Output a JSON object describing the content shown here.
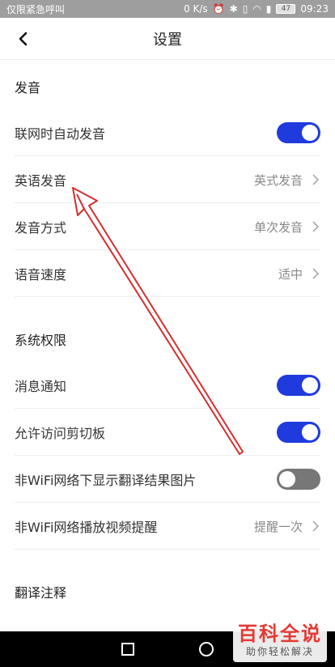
{
  "status_bar": {
    "left_text": "仅限紧急呼叫",
    "speed": "0 K/s",
    "battery": "47",
    "time": "09:23"
  },
  "header": {
    "title": "设置"
  },
  "sections": [
    {
      "title": "发音",
      "items": [
        {
          "label": "联网时自动发音",
          "toggle": true
        },
        {
          "label": "英语发音",
          "value": "英式发音"
        },
        {
          "label": "发音方式",
          "value": "单次发音"
        },
        {
          "label": "语音速度",
          "value": "适中"
        }
      ]
    },
    {
      "title": "系统权限",
      "items": [
        {
          "label": "消息通知",
          "toggle": true
        },
        {
          "label": "允许访问剪切板",
          "toggle": true
        },
        {
          "label": "非WiFi网络下显示翻译结果图片",
          "toggle": false
        },
        {
          "label": "非WiFi网络播放视频提醒",
          "value": "提醒一次"
        }
      ]
    },
    {
      "title": "翻译注释"
    }
  ],
  "watermark": {
    "main": "百科全说",
    "sub": "助你轻松解决"
  },
  "colors": {
    "accent": "#1f3bde",
    "toggle_off": "#777777",
    "annotation_arrow": "#d32f2f",
    "statusbar_bg": "#9e9e9e"
  }
}
